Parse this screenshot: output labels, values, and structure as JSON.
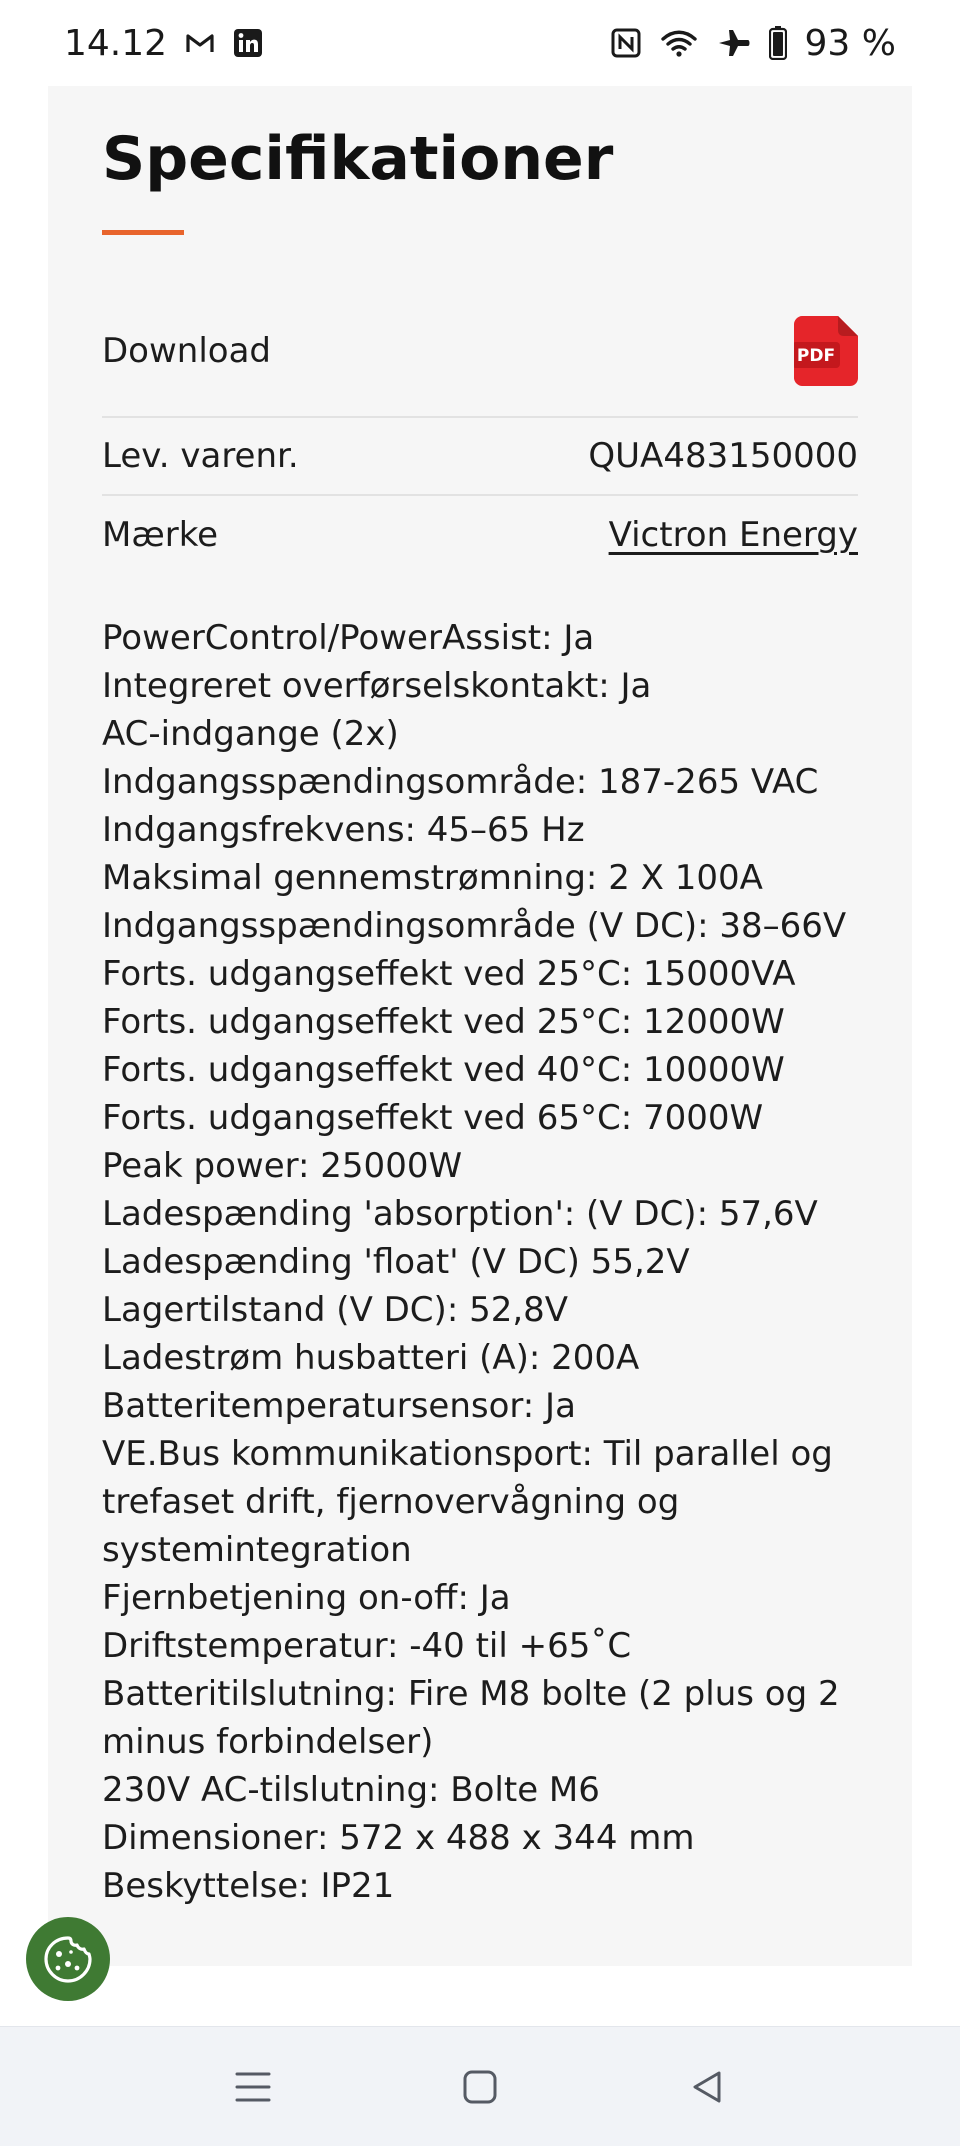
{
  "status_bar": {
    "time": "14.12",
    "battery": "93 %",
    "left_icons": [
      "gmail-icon",
      "linkedin-icon"
    ],
    "right_icons": [
      "nfc-icon",
      "wifi-icon",
      "airplane-icon",
      "battery-icon"
    ]
  },
  "specs": {
    "title": "Specifikationer",
    "accent_color": "#e8642c",
    "download_label": "Download",
    "pdf_icon_text": "PDF",
    "varenr_label": "Lev. varenr.",
    "varenr_value": "QUA483150000",
    "brand_label": "Mærke",
    "brand_value": "Victron Energy",
    "lines": [
      "PowerControl/PowerAssist: Ja",
      "Integreret overførselskontakt: Ja",
      "AC-indgange (2x)",
      "Indgangsspændingsområde: 187-265 VAC",
      "Indgangsfrekvens: 45–65 Hz",
      "Maksimal gennemstrømning: 2 X 100A",
      "Indgangsspændingsområde (V DC): 38–66V",
      "Forts. udgangseffekt ved 25°C: 15000VA",
      "Forts. udgangseffekt ved 25°C: 12000W",
      "Forts. udgangseffekt ved 40°C: 10000W",
      "Forts. udgangseffekt ved 65°C: 7000W",
      "Peak power: 25000W",
      "Ladespænding 'absorption': (V DC): 57,6V",
      "Ladespænding 'float' (V DC) 55,2V",
      "Lagertilstand (V DC): 52,8V",
      "Ladestrøm husbatteri (A): 200A",
      "Batteritemperatursensor: Ja",
      "VE.Bus kommunikationsport: Til parallel og",
      "trefaset drift, fjernovervågning og",
      "systemintegration",
      "Fjernbetjening on-off: Ja",
      "Driftstemperatur: -40 til +65˚C",
      "Batteritilslutning: Fire M8 bolte (2 plus og 2",
      "minus forbindelser)",
      "230V AC-tilslutning: Bolte M6",
      "Dimensioner: 572 x 488 x 344 mm",
      "Beskyttelse: IP21"
    ]
  },
  "cookie_button": {
    "icon": "cookie-icon",
    "color": "#3f7a33"
  },
  "nav_bar": {
    "icons": [
      "menu-icon",
      "home-icon",
      "back-icon"
    ]
  }
}
